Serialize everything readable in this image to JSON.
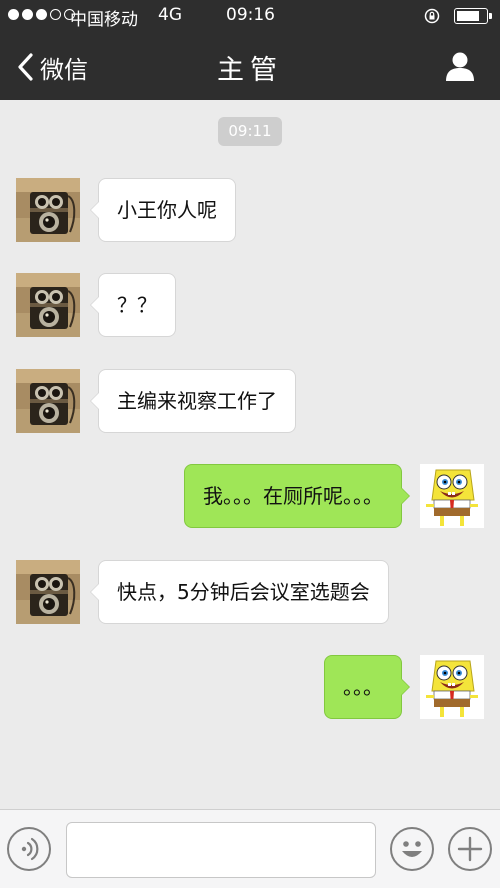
{
  "status_bar": {
    "carrier": "中国移动",
    "network": "4G",
    "time": "09:16",
    "signal_bars_filled": 3,
    "signal_bars_total": 5,
    "battery_level": 0.85
  },
  "nav": {
    "back_label": "微信",
    "title": "主管",
    "back_icon": "chevron-left-icon",
    "profile_icon": "person-icon"
  },
  "chat": {
    "timestamp": "09:11",
    "messages": [
      {
        "side": "in",
        "text": "小王你人呢"
      },
      {
        "side": "in",
        "text": "？？"
      },
      {
        "side": "in",
        "text": "主编来视察工作了"
      },
      {
        "side": "out",
        "text": "我。。。在厕所呢。。。"
      },
      {
        "side": "in",
        "text": "快点，5分钟后会议室选题会"
      },
      {
        "side": "out",
        "text": "。。。"
      }
    ]
  },
  "input_bar": {
    "voice_icon": "voice-icon",
    "emoji_icon": "emoji-icon",
    "plus_icon": "plus-icon",
    "text_value": ""
  },
  "colors": {
    "header_bg": "#2e2e2e",
    "chat_bg": "#ebebeb",
    "outgoing_bubble": "#9fe657",
    "incoming_bubble": "#ffffff"
  }
}
